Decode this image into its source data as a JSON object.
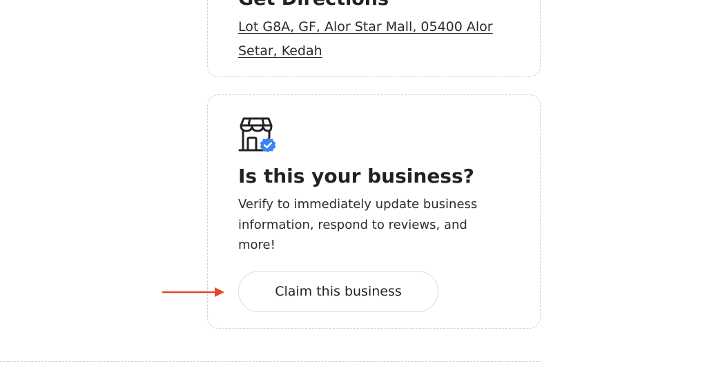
{
  "directions": {
    "title": "Get Directions",
    "address": "Lot G8A, GF, Alor Star Mall, 05400 Alor Setar, Kedah"
  },
  "claim": {
    "icon": "storefront-verified-icon",
    "title": "Is this your business?",
    "description": "Verify to immediately update business information, respond to reviews, and more!",
    "button_label": "Claim this business"
  },
  "annotation": {
    "arrow_color": "#e4462c"
  },
  "colors": {
    "verified_badge": "#3b82f6",
    "text": "#222222",
    "border": "#cfcfcf"
  }
}
